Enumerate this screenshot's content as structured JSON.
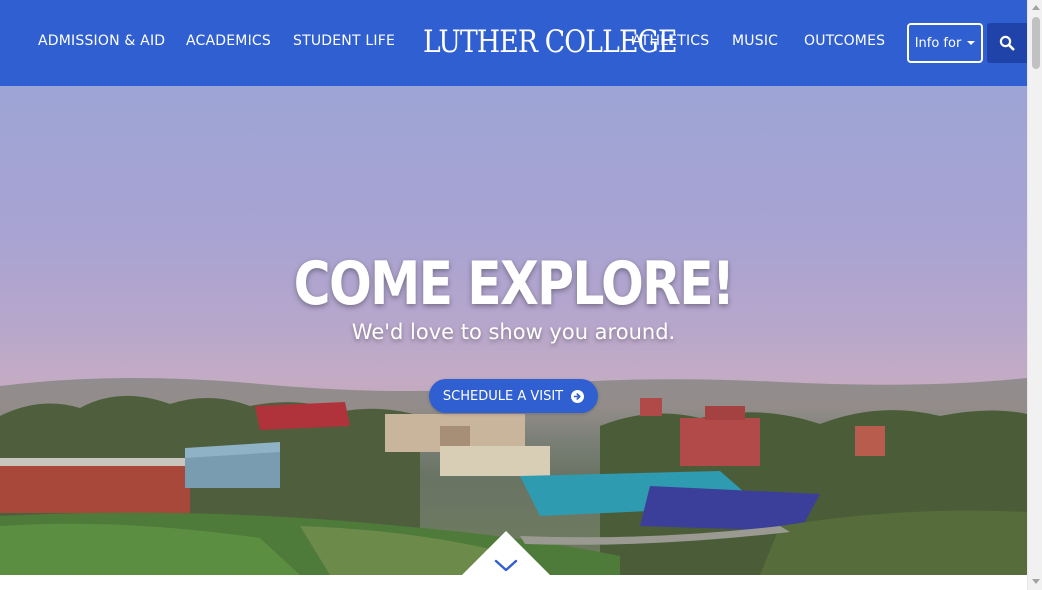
{
  "header": {
    "nav_left": [
      {
        "label": "ADMISSION & AID"
      },
      {
        "label": "ACADEMICS"
      },
      {
        "label": "STUDENT LIFE"
      }
    ],
    "logo_text": "LUTHER COLLEGE",
    "nav_right": [
      {
        "label": "ATHLETICS"
      },
      {
        "label": "MUSIC"
      },
      {
        "label": "OUTCOMES"
      }
    ],
    "info_button_label": "Info for",
    "search_icon": "search-icon"
  },
  "hero": {
    "title": "COME EXPLORE!",
    "subtitle": "We'd love to show you around.",
    "cta_label": "SCHEDULE A VISIT",
    "cta_icon": "arrow-circle-right-icon",
    "scroll_icon": "chevron-down-icon"
  },
  "colors": {
    "brand_blue": "#2f5fd1",
    "search_bg": "#1f43a8"
  }
}
